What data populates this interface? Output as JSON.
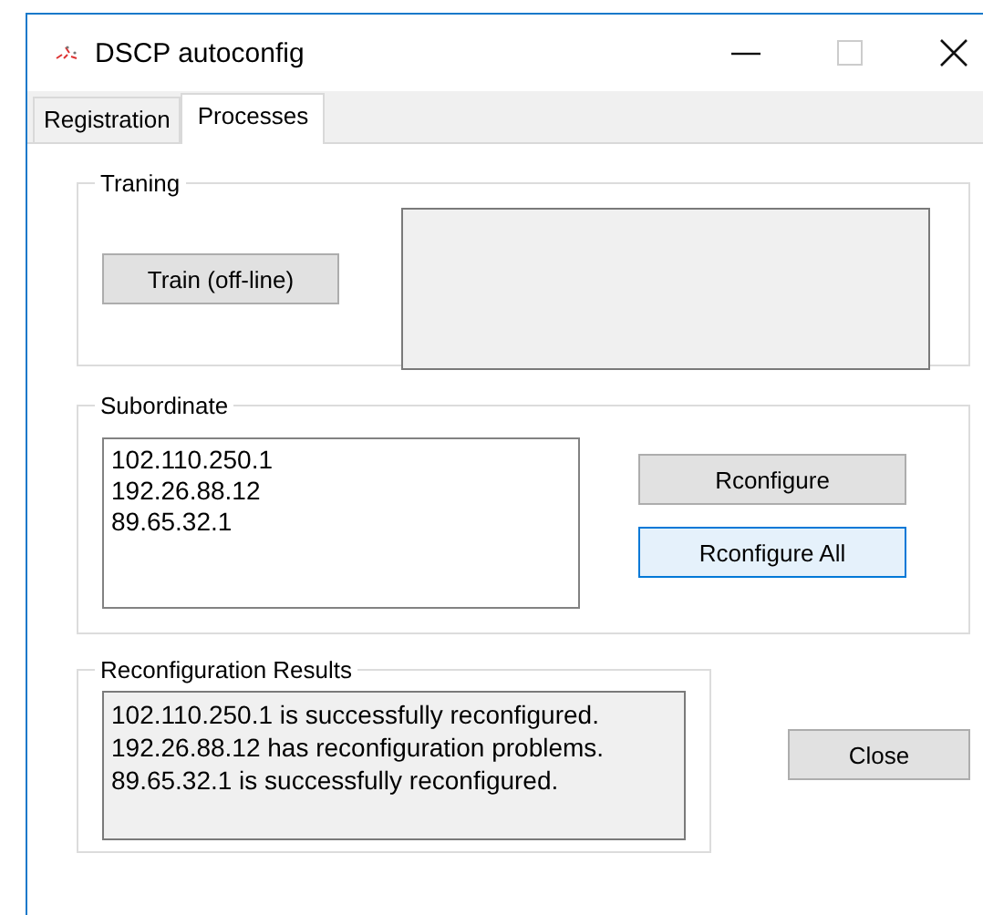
{
  "window": {
    "title": "DSCP autoconfig"
  },
  "tabs": [
    {
      "label": "Registration",
      "selected": false
    },
    {
      "label": "Processes",
      "selected": true
    }
  ],
  "training": {
    "title": "Traning",
    "button": "Train (off-line)"
  },
  "subordinate": {
    "title": "Subordinate",
    "items": [
      "102.110.250.1",
      "192.26.88.12",
      "89.65.32.1"
    ],
    "buttons": [
      {
        "label": "Rconfigure",
        "focused": false
      },
      {
        "label": "Rconfigure All",
        "focused": true
      }
    ]
  },
  "results": {
    "title": "Reconfiguration Results",
    "lines": [
      "102.110.250.1 is successfully reconfigured.",
      "192.26.88.12 has reconfiguration problems.",
      "89.65.32.1 is successfully reconfigured."
    ]
  },
  "close_button": "Close"
}
